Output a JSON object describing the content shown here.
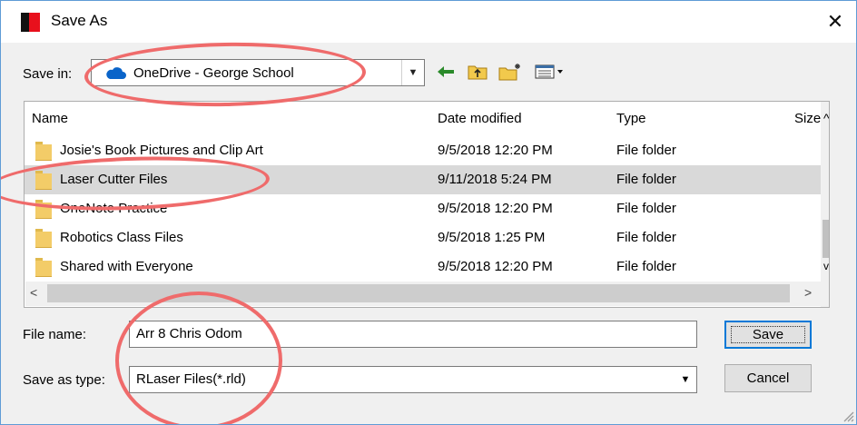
{
  "window": {
    "title": "Save As"
  },
  "save_in": {
    "label": "Save in:",
    "value": "OneDrive - George School"
  },
  "toolbar": {
    "icons": [
      "back-arrow-icon",
      "up-folder-icon",
      "new-folder-icon",
      "view-menu-icon"
    ]
  },
  "file_list": {
    "columns": [
      "Name",
      "Date modified",
      "Type",
      "Size"
    ],
    "rows": [
      {
        "name": "Josie's Book Pictures and Clip Art",
        "date": "9/5/2018 12:20 PM",
        "type": "File folder",
        "selected": false
      },
      {
        "name": "Laser Cutter Files",
        "date": "9/11/2018 5:24 PM",
        "type": "File folder",
        "selected": true
      },
      {
        "name": "OneNote Practice",
        "date": "9/5/2018 12:20 PM",
        "type": "File folder",
        "selected": false
      },
      {
        "name": "Robotics Class Files",
        "date": "9/5/2018 1:25 PM",
        "type": "File folder",
        "selected": false
      },
      {
        "name": "Shared with Everyone",
        "date": "9/5/2018 12:20 PM",
        "type": "File folder",
        "selected": false
      }
    ]
  },
  "file_name": {
    "label": "File name:",
    "value": "Arr 8 Chris Odom"
  },
  "save_as_type": {
    "label": "Save as type:",
    "value": "RLaser Files(*.rld)"
  },
  "buttons": {
    "save": "Save",
    "cancel": "Cancel"
  },
  "colors": {
    "accent": "#0078d7",
    "annotation": "#ef6b6b",
    "selected_row": "#d9d9d9",
    "folder": "#f3cc68"
  }
}
